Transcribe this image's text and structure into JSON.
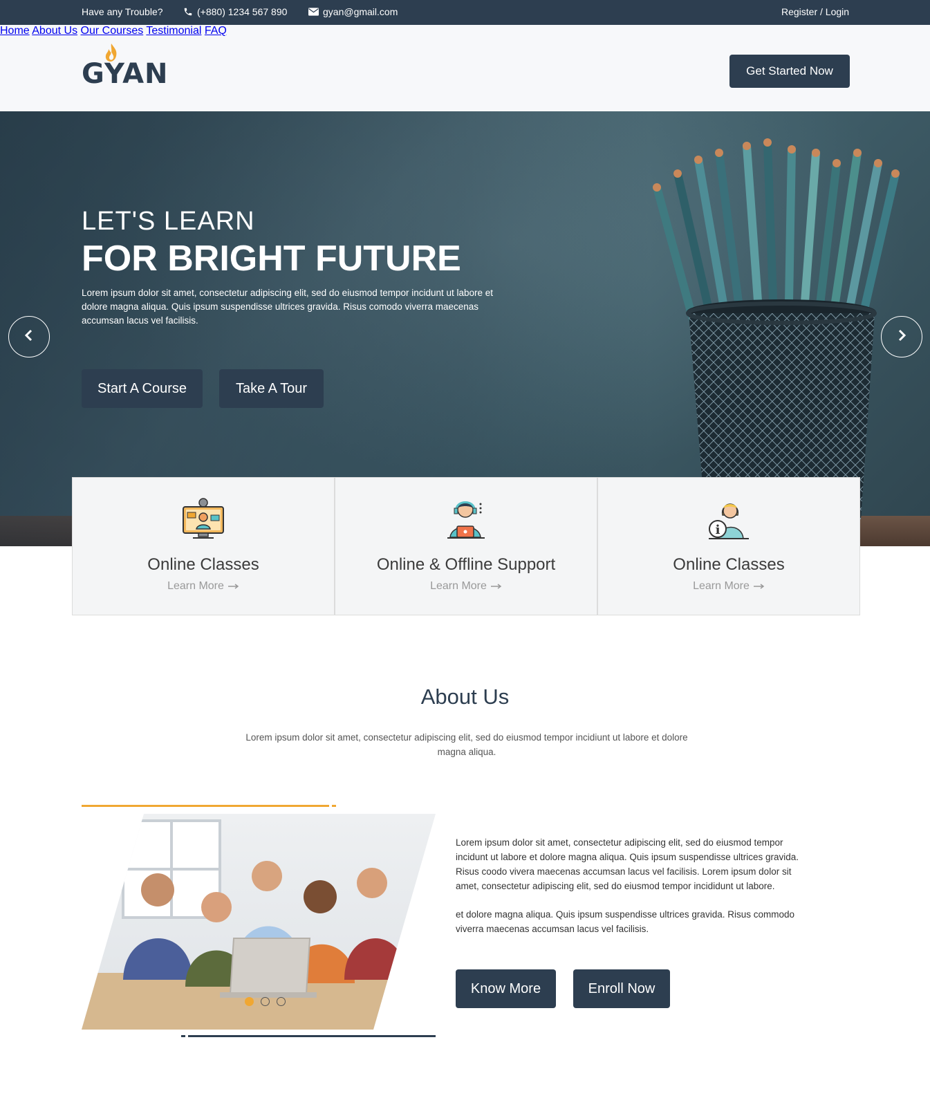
{
  "topbar": {
    "trouble": "Have any Trouble?",
    "phone": "(+880) 1234 567 890",
    "email": "gyan@gmail.com",
    "auth": "Register / Login"
  },
  "header": {
    "logo_text": "GYAN",
    "nav": [
      "Home",
      "About Us",
      "Our Courses",
      "Testimonial",
      "FAQ"
    ],
    "cta": "Get Started Now"
  },
  "hero": {
    "subtitle": "LET'S LEARN",
    "title": "FOR BRIGHT FUTURE",
    "description": "Lorem ipsum dolor sit amet, consectetur adipiscing elit, sed do eiusmod tempor incidunt ut labore et dolore magna aliqua. Quis ipsum suspendisse ultrices gravida. Risus comodo viverra maecenas accumsan lacus vel facilisis.",
    "btn_primary": "Start A Course",
    "btn_secondary": "Take A Tour"
  },
  "features": [
    {
      "title": "Online Classes",
      "link": "Learn More",
      "icon": "online-classes-icon"
    },
    {
      "title": "Online & Offline Support",
      "link": "Learn More",
      "icon": "support-agent-icon"
    },
    {
      "title": "Online Classes",
      "link": "Learn More",
      "icon": "info-assistant-icon"
    }
  ],
  "about": {
    "title": "About Us",
    "intro": "Lorem ipsum dolor sit amet, consectetur adipiscing elit, sed do eiusmod tempor incidiunt ut labore et dolore magna aliqua.",
    "paragraph1": "Lorem ipsum dolor sit amet, consectetur adipiscing elit, sed do eiusmod tempor incidunt ut labore et dolore magna aliqua. Quis ipsum suspendisse ultrices gravida. Risus coodo vivera maecenas accumsan lacus vel facilisis. Lorem ipsum dolor sit amet, consectetur adipiscing elit, sed do eiusmod tempor incididunt ut labore.",
    "paragraph2": "et dolore magna aliqua. Quis ipsum suspendisse ultrices gravida. Risus commodo viverra maecenas accumsan lacus vel facilisis.",
    "btn_know": "Know More",
    "btn_enroll": "Enroll Now",
    "carousel_active": 1,
    "carousel_total": 3
  },
  "colors": {
    "dark": "#2d3e50",
    "accent": "#f0a732",
    "card_bg": "#f4f5f6"
  }
}
